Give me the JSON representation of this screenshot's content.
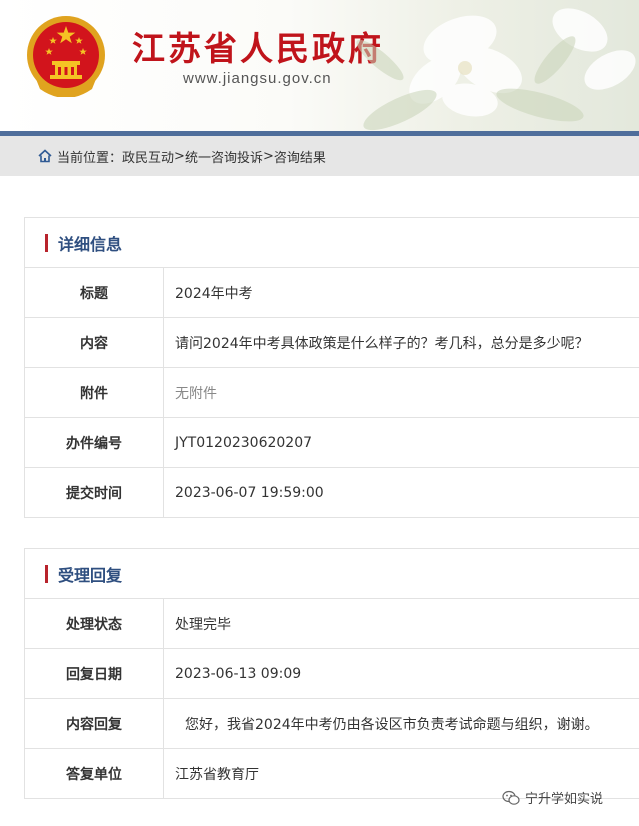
{
  "header": {
    "site_title": "江苏省人民政府",
    "site_url": "www.jiangsu.gov.cn",
    "brand_color": "#c0141b",
    "bar_color": "#4f6e9b"
  },
  "breadcrumb": {
    "icon": "home-icon",
    "prefix": "当前位置：",
    "items": [
      "政民互动",
      "统一咨询投诉",
      "咨询结果"
    ],
    "separator": ">"
  },
  "details": {
    "section_title": "详细信息",
    "rows": [
      {
        "label": "标题",
        "value": "2024年中考"
      },
      {
        "label": "内容",
        "value": "请问2024年中考具体政策是什么样子的？考几科，总分是多少呢？"
      },
      {
        "label": "附件",
        "value": "无附件"
      },
      {
        "label": "办件编号",
        "value": "JYT0120230620207"
      },
      {
        "label": "提交时间",
        "value": "2023-06-07 19:59:00"
      }
    ]
  },
  "reply": {
    "section_title": "受理回复",
    "rows": [
      {
        "label": "处理状态",
        "value": "处理完毕"
      },
      {
        "label": "回复日期",
        "value": "2023-06-13 09:09"
      },
      {
        "label": "内容回复",
        "value": "您好，我省2024年中考仍由各设区市负责考试命题与组织，谢谢。"
      },
      {
        "label": "答复单位",
        "value": "江苏省教育厅"
      }
    ]
  },
  "watermark": {
    "icon": "wechat-icon",
    "text": "宁升学如实说"
  }
}
